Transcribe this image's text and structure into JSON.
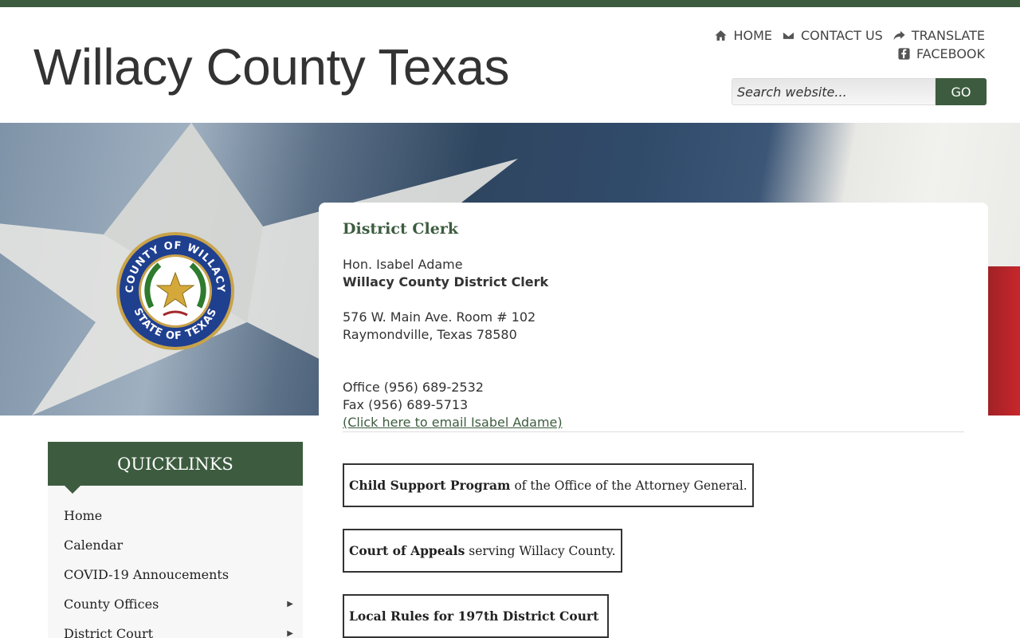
{
  "site": {
    "title": "Willacy County Texas"
  },
  "toplinks": [
    {
      "label": "HOME",
      "icon": "home-icon"
    },
    {
      "label": "CONTACT US",
      "icon": "envelope-icon"
    },
    {
      "label": "TRANSLATE",
      "icon": "share-arrow-icon"
    }
  ],
  "toplinks2": [
    {
      "label": "FACEBOOK",
      "icon": "facebook-icon"
    }
  ],
  "search": {
    "placeholder": "Search website...",
    "button": "GO"
  },
  "seal": {
    "top_text": "COUNTY OF WILLACY",
    "bottom_text": "STATE OF TEXAS"
  },
  "content": {
    "title": "District Clerk",
    "name": "Hon. Isabel Adame",
    "role": "Willacy County District Clerk",
    "address1": "576 W. Main Ave. Room # 102",
    "address2": "Raymondville, Texas 78580",
    "office": "Office (956) 689-2532",
    "fax": "Fax (956) 689-5713",
    "email_link": "(Click here to email Isabel Adame)"
  },
  "boxlinks": [
    {
      "bold": "Child Support Program",
      "rest": "of the Office of the Attorney General."
    },
    {
      "bold": "Court of Appeals",
      "rest": "serving Willacy County."
    },
    {
      "bold": "Local Rules for 197th District Court",
      "rest": ""
    }
  ],
  "quicklinks": {
    "title": "QUICKLINKS",
    "items": [
      {
        "label": "Home",
        "submenu": ""
      },
      {
        "label": "Calendar",
        "submenu": ""
      },
      {
        "label": "COVID-19 Annoucements",
        "submenu": ""
      },
      {
        "label": "County Offices",
        "submenu": "▶"
      },
      {
        "label": "District Court",
        "submenu": "▶"
      }
    ]
  },
  "colors": {
    "brand_green": "#3d5c3f"
  }
}
